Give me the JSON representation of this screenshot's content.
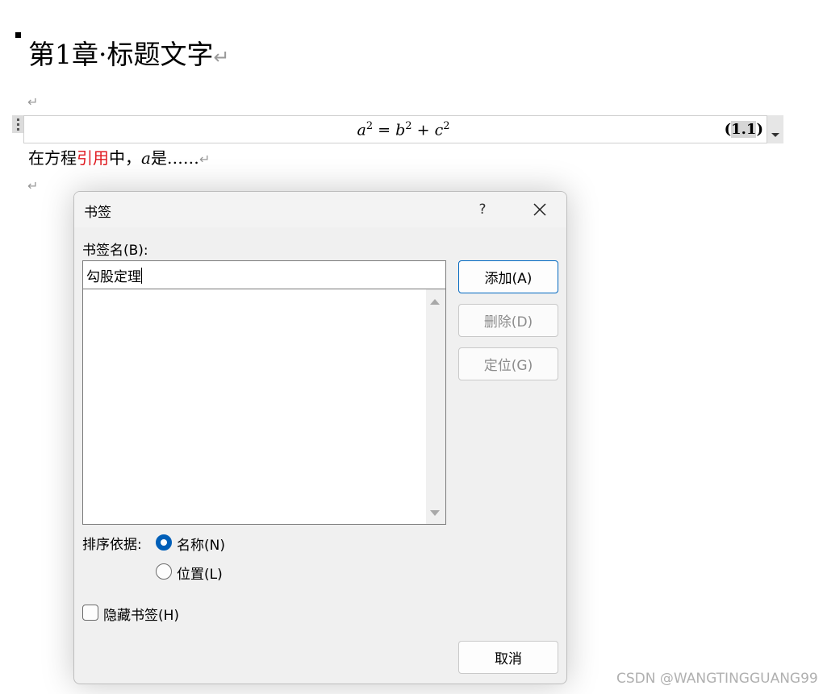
{
  "document": {
    "heading": "第1章·标题文字",
    "paragraph_mark": "↵",
    "equation": {
      "text_a": "a",
      "text_eq": " = ",
      "text_b": "b",
      "text_plus": " + ",
      "text_c": "c",
      "exponent": "2",
      "number_open": "(",
      "number_value": "1.1",
      "number_close": ")"
    },
    "paragraph": {
      "before": "在方程",
      "ref": "引用",
      "middle": "中，",
      "var": "a",
      "after": "是……",
      "ref_color": "#e0191f"
    }
  },
  "dialog": {
    "title": "书签",
    "help": "?",
    "name_label": "书签名(B):",
    "name_value": "勾股定理",
    "buttons": {
      "add": "添加(A)",
      "delete": "删除(D)",
      "goto": "定位(G)",
      "cancel": "取消"
    },
    "sort_label": "排序依据:",
    "sort_options": [
      {
        "label": "名称(N)",
        "selected": true
      },
      {
        "label": "位置(L)",
        "selected": false
      }
    ],
    "hidden_label": "隐藏书签(H)",
    "hidden_checked": false,
    "accent_color": "#005fb8"
  },
  "watermark": "CSDN @WANGTINGGUANG99",
  "icons": {
    "close": "close-icon",
    "scroll_up": "scroll-up-icon",
    "scroll_down": "scroll-down-icon",
    "handle": "drag-handle-icon",
    "dropdown": "dropdown-arrow-icon"
  }
}
